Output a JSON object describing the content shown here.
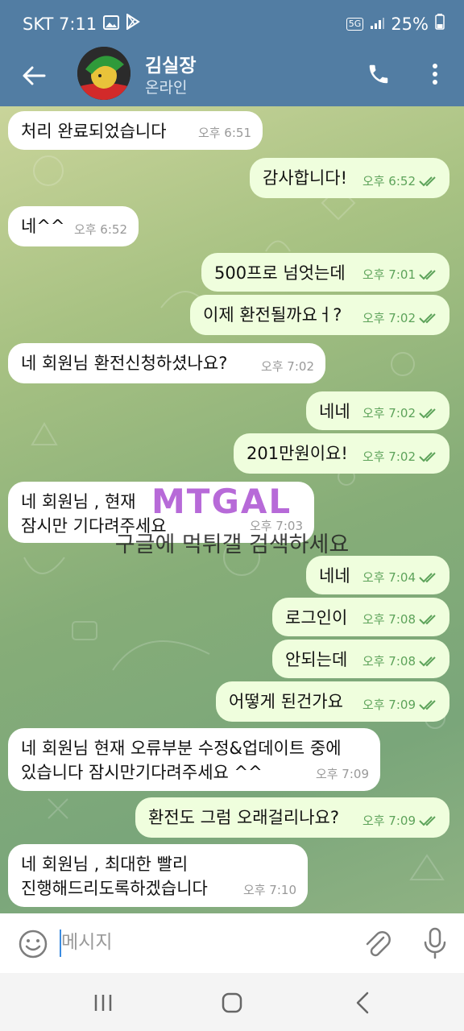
{
  "status_bar": {
    "carrier_time": "SKT 7:11",
    "network": "5G",
    "battery": "25%"
  },
  "header": {
    "name": "김실장",
    "status": "온라인"
  },
  "messages": [
    {
      "text": "처리 완료되었습니다",
      "time": "오후 6:51",
      "dir": "in"
    },
    {
      "text": "감사합니다!",
      "time": "오후 6:52",
      "dir": "out"
    },
    {
      "text": "네^^",
      "time": "오후 6:52",
      "dir": "in"
    },
    {
      "text": "500프로 넘엇는데",
      "time": "오후 7:01",
      "dir": "out"
    },
    {
      "text": "이제 환전될까요ㅓ?",
      "time": "오후 7:02",
      "dir": "out"
    },
    {
      "text": "네 회원님 환전신청하셨나요?",
      "time": "오후 7:02",
      "dir": "in"
    },
    {
      "text": "네네",
      "time": "오후 7:02",
      "dir": "out"
    },
    {
      "text": "201만원이요!",
      "time": "오후 7:02",
      "dir": "out"
    },
    {
      "text": "네 회원님 , 현재",
      "text2": "잠시만 기다려주세요",
      "time": "오후 7:03",
      "dir": "in"
    },
    {
      "text": "네네",
      "time": "오후 7:04",
      "dir": "out"
    },
    {
      "text": "로그인이",
      "time": "오후 7:08",
      "dir": "out"
    },
    {
      "text": "안되는데",
      "time": "오후 7:08",
      "dir": "out"
    },
    {
      "text": "어떻게 된건가요",
      "time": "오후 7:09",
      "dir": "out"
    },
    {
      "text": "네 회원님 현재 오류부분 수정&업데이트 중에",
      "text2": "있습니다 잠시만기다려주세요 ^^",
      "time": "오후 7:09",
      "dir": "in"
    },
    {
      "text": "환전도 그럼 오래걸리나요?",
      "time": "오후 7:09",
      "dir": "out"
    },
    {
      "text": "네 회원님 , 최대한 빨리",
      "text2": "진행해드리도록하겠습니다",
      "time": "오후 7:10",
      "dir": "in"
    }
  ],
  "watermark": {
    "logo": "MTGAL",
    "text": "구글에 먹튀갤 검색하세요"
  },
  "input": {
    "placeholder": "메시지"
  },
  "icons": {
    "back": "back-arrow-icon",
    "call": "phone-icon",
    "more": "more-vert-icon",
    "emoji": "emoji-icon",
    "attach": "paperclip-icon",
    "mic": "microphone-icon",
    "read": "double-check-icon"
  },
  "colors": {
    "header": "#527da3",
    "bubble_out": "#effedd",
    "bubble_in": "#ffffff",
    "read_check": "#5da35a"
  }
}
